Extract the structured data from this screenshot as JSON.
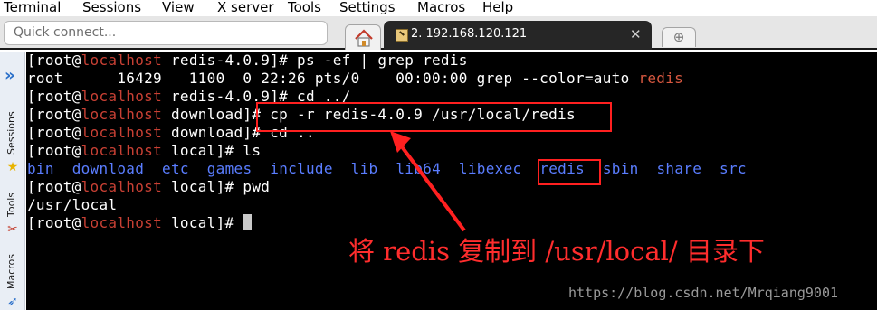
{
  "menu": [
    "Terminal",
    "Sessions",
    "View",
    "X server",
    "Tools",
    "Settings",
    "Macros",
    "Help"
  ],
  "toolbar": {
    "quick_connect_placeholder": "Quick connect...",
    "home_icon": "home-icon",
    "session_tab_label": "2. 192.168.120.121",
    "close_glyph": "✕",
    "new_tab_glyph": "⊕"
  },
  "sidebar": {
    "expand_glyph": "»",
    "labels": [
      "Sessions",
      "Tools",
      "Macros"
    ],
    "icons": [
      "star-icon",
      "tools-icon",
      "macros-icon"
    ]
  },
  "terminal": {
    "lines": [
      {
        "pre": "[root@",
        "host": "localhost",
        "post": " redis-4.0.9]# ps -ef | grep redis"
      },
      {
        "plain": "root      16429   1100  0 22:26 pts/0    00:00:00 grep --color=auto ",
        "hl": "redis"
      },
      {
        "pre": "[root@",
        "host": "localhost",
        "post": " redis-4.0.9]# cd ../"
      },
      {
        "pre": "[root@",
        "host": "localhost",
        "post": " download]# cp -r redis-4.0.9 /usr/local/redis"
      },
      {
        "pre": "[root@",
        "host": "localhost",
        "post": " download]# cd .."
      },
      {
        "pre": "[root@",
        "host": "localhost",
        "post": " local]# ls"
      },
      {
        "dirs": [
          "bin",
          "download",
          "etc",
          "games",
          "include",
          "lib",
          "lib64",
          "libexec",
          "redis",
          "sbin",
          "share",
          "src"
        ]
      },
      {
        "pre": "[root@",
        "host": "localhost",
        "post": " local]# pwd"
      },
      {
        "plain": "/usr/local"
      },
      {
        "pre": "[root@",
        "host": "localhost",
        "post": " local]# "
      }
    ]
  },
  "annotation": "将 redis 复制到 /usr/local/ 目录下",
  "watermark": "https://blog.csdn.net/Mrqiang9001",
  "colors": {
    "host": "#c84034",
    "dir": "#5a7dff",
    "annotation": "#ff2d2d",
    "terminal_bg": "#000000"
  }
}
